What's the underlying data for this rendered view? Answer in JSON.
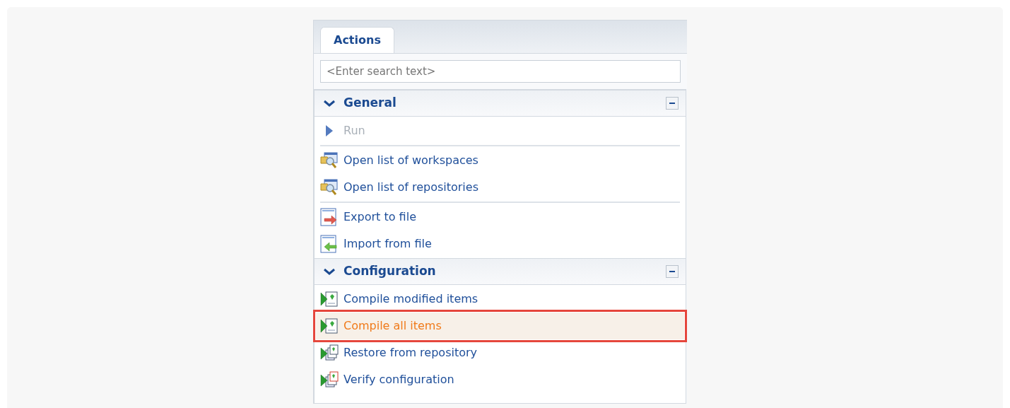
{
  "tabs": [
    {
      "label": "Actions",
      "selected": true
    }
  ],
  "search": {
    "placeholder": "<Enter search text>"
  },
  "sections": [
    {
      "title": "General",
      "expanded": true,
      "groups": [
        [
          {
            "label": "Run",
            "kind": "run",
            "disabled": true,
            "selected": false
          }
        ],
        [
          {
            "label": "Open list of workspaces",
            "kind": "search",
            "disabled": false,
            "selected": false
          },
          {
            "label": "Open list of repositories",
            "kind": "search",
            "disabled": false,
            "selected": false
          }
        ],
        [
          {
            "label": "Export to file",
            "kind": "export",
            "disabled": false,
            "selected": false
          },
          {
            "label": "Import from file",
            "kind": "import",
            "disabled": false,
            "selected": false
          }
        ]
      ]
    },
    {
      "title": "Configuration",
      "expanded": true,
      "groups": [
        [
          {
            "label": "Compile modified items",
            "kind": "compile",
            "disabled": false,
            "selected": false
          },
          {
            "label": "Compile all items",
            "kind": "compile",
            "disabled": false,
            "selected": true
          },
          {
            "label": "Restore from repository",
            "kind": "restore",
            "disabled": false,
            "selected": false
          },
          {
            "label": "Verify configuration",
            "kind": "verify",
            "disabled": false,
            "selected": false
          }
        ]
      ]
    }
  ]
}
